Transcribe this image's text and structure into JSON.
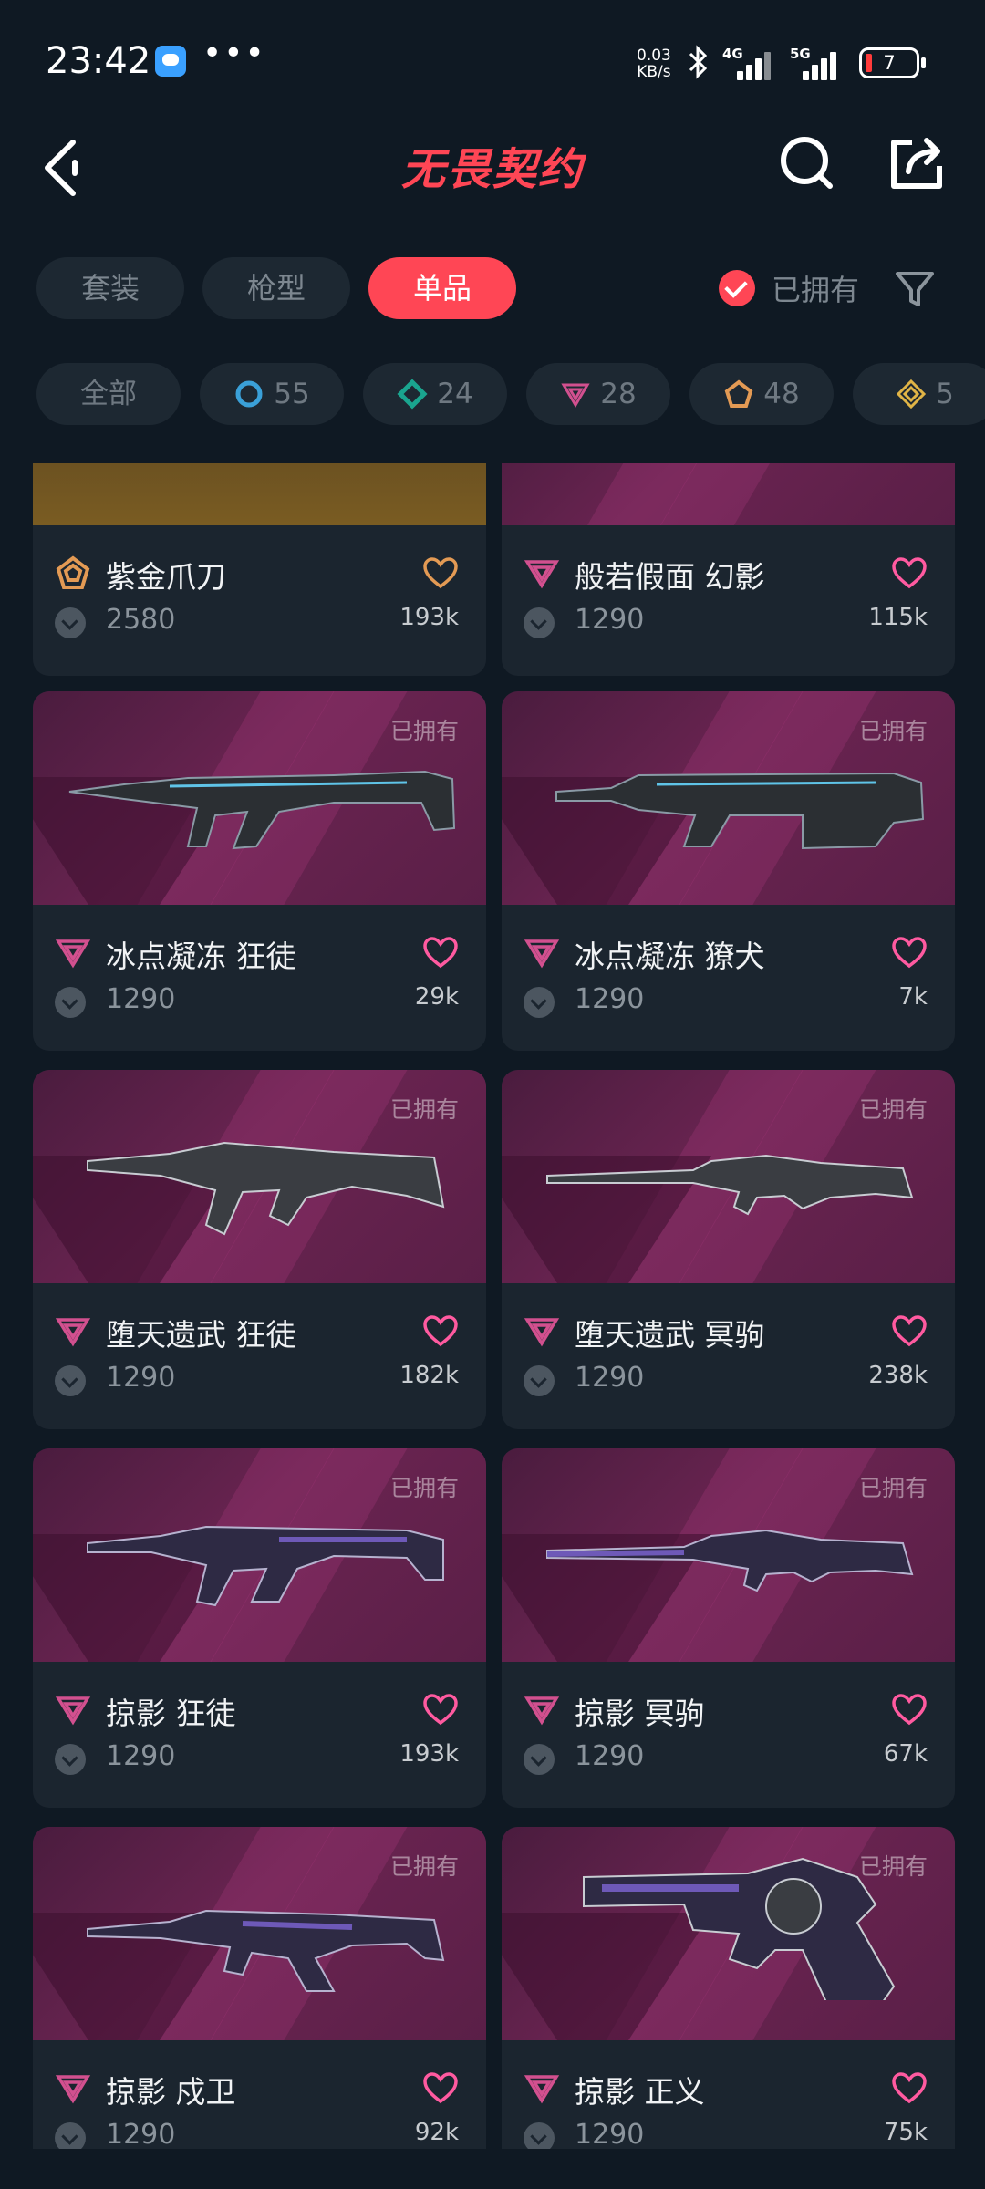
{
  "status": {
    "time": "23:42",
    "speed_value": "0.03",
    "speed_unit": "KB/s",
    "net1": "4G",
    "net2": "5G",
    "battery": "7",
    "dots": "•••"
  },
  "header": {
    "title": "无畏契约"
  },
  "tabs": [
    {
      "label": "套装"
    },
    {
      "label": "枪型"
    },
    {
      "label": "单品",
      "active": true
    }
  ],
  "owned_filter": {
    "label": "已拥有"
  },
  "chips": [
    {
      "label": "全部"
    },
    {
      "label": "55",
      "icon": "select-tier-icon",
      "color": "#3aa0d8"
    },
    {
      "label": "24",
      "icon": "deluxe-tier-icon",
      "color": "#1aa58f"
    },
    {
      "label": "28",
      "icon": "premium-tier-icon",
      "color": "#d2508f"
    },
    {
      "label": "48",
      "icon": "exclusive-tier-icon",
      "color": "#e39a54"
    },
    {
      "label": "5",
      "icon": "ultra-tier-icon",
      "color": "#e0b446"
    }
  ],
  "items": [
    {
      "name": "紫金爪刀",
      "price": "2580",
      "likes": "193k",
      "tier_color": "#e39a54",
      "heart_color": "#e39a54"
    },
    {
      "name": "般若假面 幻影",
      "price": "1290",
      "likes": "115k",
      "tier_color": "#d2508f",
      "heart_color": "#ff5aa0"
    },
    {
      "name": "冰点凝冻 狂徒",
      "price": "1290",
      "likes": "29k",
      "owned": "已拥有",
      "tier_color": "#d2508f",
      "heart_color": "#ff5aa0"
    },
    {
      "name": "冰点凝冻 獠犬",
      "price": "1290",
      "likes": "7k",
      "owned": "已拥有",
      "tier_color": "#d2508f",
      "heart_color": "#ff5aa0"
    },
    {
      "name": "堕天遗武 狂徒",
      "price": "1290",
      "likes": "182k",
      "owned": "已拥有",
      "tier_color": "#d2508f",
      "heart_color": "#ff5aa0"
    },
    {
      "name": "堕天遗武 冥驹",
      "price": "1290",
      "likes": "238k",
      "owned": "已拥有",
      "tier_color": "#d2508f",
      "heart_color": "#ff5aa0"
    },
    {
      "name": "掠影 狂徒",
      "price": "1290",
      "likes": "193k",
      "owned": "已拥有",
      "tier_color": "#d2508f",
      "heart_color": "#ff5aa0"
    },
    {
      "name": "掠影 冥驹",
      "price": "1290",
      "likes": "67k",
      "owned": "已拥有",
      "tier_color": "#d2508f",
      "heart_color": "#ff5aa0"
    },
    {
      "name": "掠影 戍卫",
      "price": "1290",
      "likes": "92k",
      "owned": "已拥有",
      "tier_color": "#d2508f",
      "heart_color": "#ff5aa0"
    },
    {
      "name": "掠影 正义",
      "price": "1290",
      "likes": "75k",
      "owned": "已拥有",
      "tier_color": "#d2508f",
      "heart_color": "#ff5aa0"
    }
  ]
}
